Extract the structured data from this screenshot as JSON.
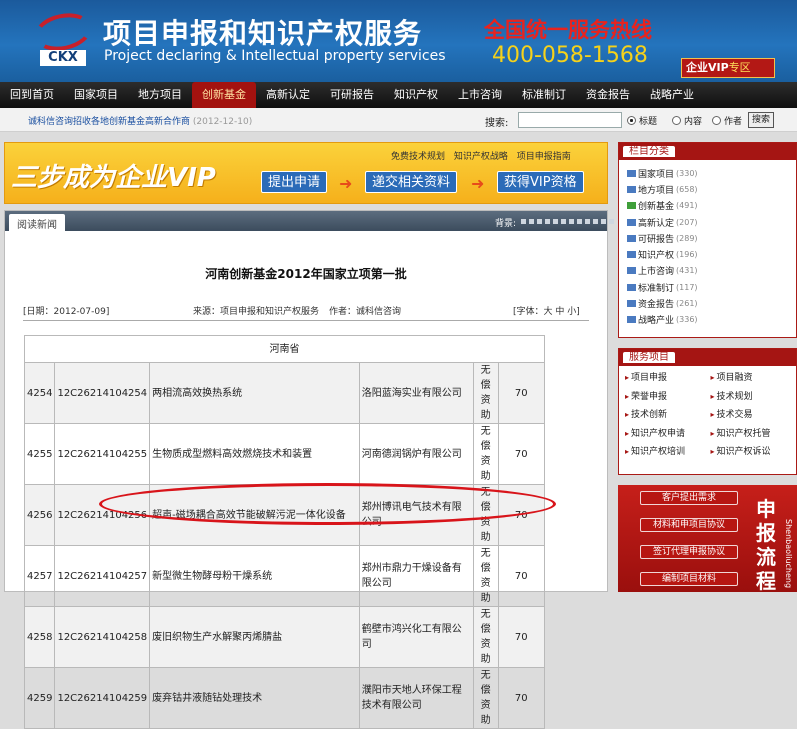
{
  "header": {
    "logo_text": "CKX",
    "title_cn": "项目申报和知识产权服务",
    "title_en": "Project declaring & Intellectual property services",
    "hotline_label": "全国统一服务热线",
    "hotline_number": "400-058-1568",
    "vip_label": "企业VIP",
    "vip_suffix": "专区"
  },
  "nav": {
    "items": [
      "回到首页",
      "国家项目",
      "地方项目",
      "创新基金",
      "高新认定",
      "可研报告",
      "知识产权",
      "上市咨询",
      "标准制订",
      "资金报告",
      "战略产业"
    ],
    "active_index": 3
  },
  "subbar": {
    "ticker_text": "诚科信咨询招收各地创新基金高新合作商",
    "ticker_date": "(2012-12-10)",
    "search_label": "搜索:",
    "search_placeholder": "",
    "radio_options": [
      "标题",
      "内容",
      "作者"
    ],
    "radio_selected": 0,
    "search_button": "搜索"
  },
  "banner": {
    "headline": "三步成为企业VIP",
    "links": [
      "免费技术规划",
      "知识产权战略",
      "项目申报指南"
    ],
    "steps": [
      "提出申请",
      "递交相关资料",
      "获得VIP资格"
    ],
    "arrow": "➜"
  },
  "article": {
    "tab_label": "阅读新闻",
    "bg_label": "背景:",
    "title": "河南创新基金2012年国家立项第一批",
    "date_text": "[日期：2012-07-09]",
    "source_text": "来源：项目申报和知识产权服务",
    "author_text": "作者：诚科信咨询",
    "font_text": "[字体：大 中 小]",
    "province": "河南省",
    "rows": [
      {
        "no": "4254",
        "code": "12C26214104254",
        "name": "两相流高效换热系统",
        "company": "洛阳蓝海实业有限公司",
        "type": "无偿资助",
        "amount": "70"
      },
      {
        "no": "4255",
        "code": "12C26214104255",
        "name": "生物质成型燃料高效燃烧技术和装置",
        "company": "河南德润锅炉有限公司",
        "type": "无偿资助",
        "amount": "70"
      },
      {
        "no": "4256",
        "code": "12C26214104256",
        "name": "超声-磁场耦合高效节能破解污泥一体化设备",
        "company": "郑州博讯电气技术有限公司",
        "type": "无偿资助",
        "amount": "70"
      },
      {
        "no": "4257",
        "code": "12C26214104257",
        "name": "新型微生物酵母粉干燥系统",
        "company": "郑州市鼎力干燥设备有限公司",
        "type": "无偿资助",
        "amount": "70"
      },
      {
        "no": "4258",
        "code": "12C26214104258",
        "name": "废旧织物生产水解聚丙烯腈盐",
        "company": "鹤壁市鸿兴化工有限公司",
        "type": "无偿资助",
        "amount": "70"
      },
      {
        "no": "4259",
        "code": "12C26214104259",
        "name": "废弃钴井液随钻处理技术",
        "company": "濮阳市天地人环保工程技术有限公司",
        "type": "无偿资助",
        "amount": "70"
      }
    ]
  },
  "sidebar": {
    "category_title": "栏目分类",
    "categories": [
      {
        "label": "国家项目",
        "count": "(330)"
      },
      {
        "label": "地方项目",
        "count": "(658)"
      },
      {
        "label": "创新基金",
        "count": "(491)"
      },
      {
        "label": "高新认定",
        "count": "(207)"
      },
      {
        "label": "可研报告",
        "count": "(289)"
      },
      {
        "label": "知识产权",
        "count": "(196)"
      },
      {
        "label": "上市咨询",
        "count": "(431)"
      },
      {
        "label": "标准制订",
        "count": "(117)"
      },
      {
        "label": "资金报告",
        "count": "(261)"
      },
      {
        "label": "战略产业",
        "count": "(336)"
      }
    ],
    "service_title": "服务项目",
    "services": [
      "项目申报",
      "项目融资",
      "荣誉申报",
      "技术规划",
      "技术创新",
      "技术交易",
      "知识产权申请",
      "知识产权托管",
      "知识产权培训",
      "知识产权诉讼"
    ],
    "flow_buttons": [
      "客户提出需求",
      "材料和申项目协议",
      "签订代理申报协议",
      "编制项目材料"
    ],
    "flow_title": [
      "申",
      "报",
      "流",
      "程"
    ],
    "flow_small": "Shenbaoliucheng"
  },
  "colors": {
    "header_blue": "#2474bd",
    "nav_active": "#a3120f",
    "side_red": "#a51513",
    "highlight_ellipse": "#d8141a"
  }
}
